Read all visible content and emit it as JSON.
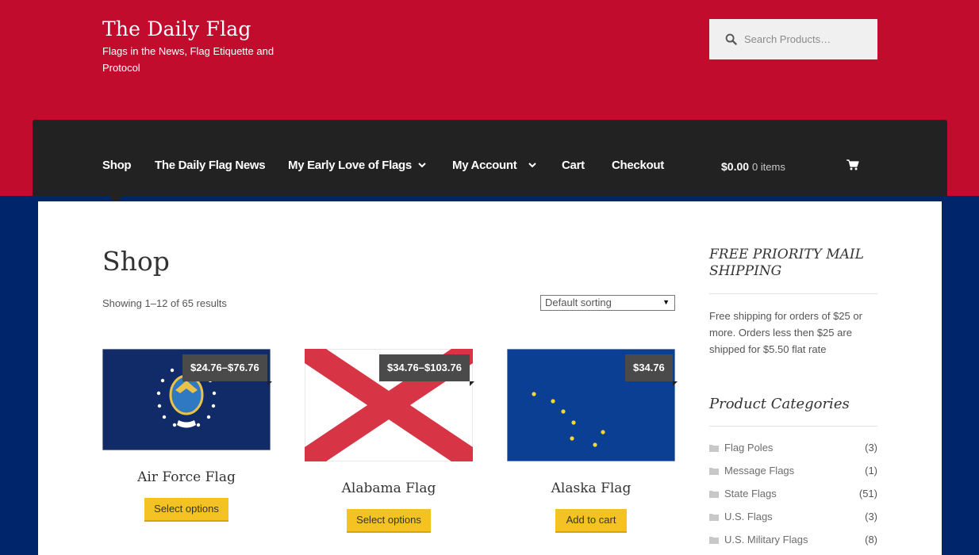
{
  "header": {
    "site_title": "The Daily Flag",
    "tagline": "Flags in the News, Flag Etiquette and Protocol",
    "search_placeholder": "Search Products…"
  },
  "nav": {
    "items": [
      {
        "label": "Shop",
        "active": true
      },
      {
        "label": "The Daily Flag News"
      },
      {
        "label": "My Early Love of Flags",
        "has_submenu": true
      },
      {
        "label": "My Account",
        "has_submenu": true
      },
      {
        "label": "Cart"
      },
      {
        "label": "Checkout"
      }
    ],
    "cart_total": "$0.00",
    "cart_count": "0 items",
    "cart_icon": "shopping-cart-icon"
  },
  "main": {
    "title": "Shop",
    "result_count": "Showing 1–12 of 65 results",
    "sort_selected": "Default sorting",
    "products": [
      {
        "name": "Air Force Flag",
        "price": "$24.76–$76.76",
        "button": "Select options"
      },
      {
        "name": "Alabama Flag",
        "price": "$34.76–$103.76",
        "button": "Select options"
      },
      {
        "name": "Alaska Flag",
        "price": "$34.76",
        "button": "Add to cart"
      }
    ]
  },
  "sidebar": {
    "shipping_title": "FREE PRIORITY MAIL SHIPPING",
    "shipping_text": "Free shipping for orders of $25 or more. Orders less then $25 are shipped for $5.50 flat rate",
    "categories_title": "Product Categories",
    "categories": [
      {
        "name": "Flag Poles",
        "count": "(3)"
      },
      {
        "name": "Message Flags",
        "count": "(1)"
      },
      {
        "name": "State Flags",
        "count": "(51)"
      },
      {
        "name": "U.S. Flags",
        "count": "(3)"
      },
      {
        "name": "U.S. Military Flags",
        "count": "(8)"
      }
    ]
  },
  "colors": {
    "header_red": "#c10c2e",
    "page_blue": "#00256a",
    "nav_dark": "#222222",
    "button_yellow": "#f5c223"
  }
}
